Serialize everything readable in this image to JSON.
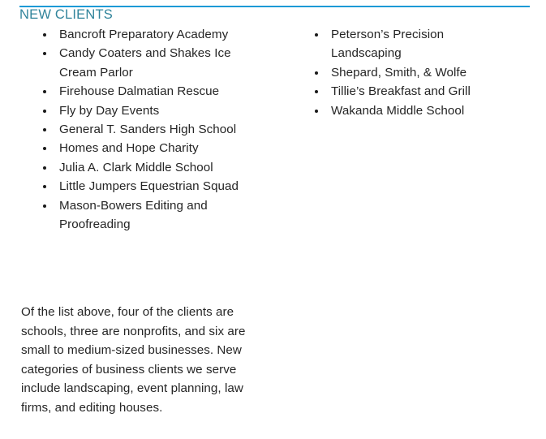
{
  "header": {
    "title": "NEW CLIENTS",
    "rule_color": "#1C9AD6",
    "title_color": "#31849B"
  },
  "columns": {
    "left": {
      "items": [
        "Bancroft Preparatory Academy",
        "Candy Coaters and Shakes Ice Cream Parlor",
        "Firehouse Dalmatian Rescue",
        "Fly by Day Events",
        "General T. Sanders High School",
        "Homes and Hope Charity",
        "Julia A. Clark Middle School",
        "Little Jumpers Equestrian Squad",
        "Mason-Bowers Editing and Proofreading"
      ]
    },
    "right": {
      "items": [
        "Peterson’s Precision Landscaping",
        "Shepard, Smith, & Wolfe",
        "Tillie’s Breakfast and Grill",
        "Wakanda Middle School"
      ]
    }
  },
  "summary": {
    "text": "Of the list above, four of the clients are schools, three are nonprofits, and six are small to medium-sized businesses. New categories of business clients we serve include landscaping, event planning, law firms, and editing houses."
  }
}
